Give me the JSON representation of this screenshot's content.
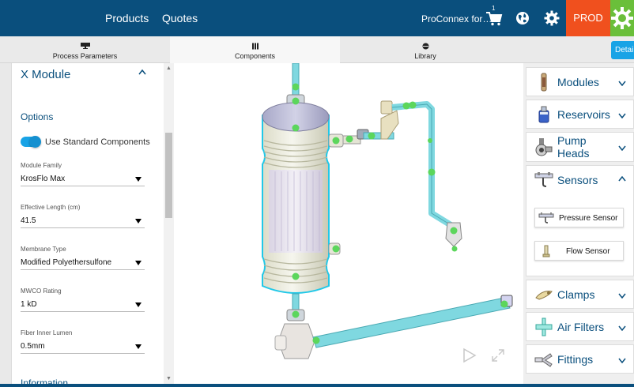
{
  "nav": {
    "products": "Products",
    "quotes": "Quotes",
    "org": "ProConnex for…",
    "cart_count": "1",
    "env": "PROD"
  },
  "tabs": [
    {
      "label": "Process Parameters",
      "icon": "monitor-icon"
    },
    {
      "label": "Components",
      "icon": "bars-icon"
    },
    {
      "label": "Library",
      "icon": "library-icon"
    }
  ],
  "detail_button": "Detai",
  "left": {
    "title": "X Module",
    "options_heading": "Options",
    "toggle_label": "Use Standard Components",
    "toggle_on": true,
    "fields": [
      {
        "label": "Module Family",
        "value": "KrosFlo Max"
      },
      {
        "label": "Effective Length (cm)",
        "value": "41.5"
      },
      {
        "label": "Membrane Type",
        "value": "Modified Polyethersulfone"
      },
      {
        "label": "MWCO Rating",
        "value": "1 kD"
      },
      {
        "label": "Fiber Inner Lumen",
        "value": "0.5mm"
      }
    ],
    "info_heading": "Information"
  },
  "right": {
    "categories": [
      {
        "label": "Modules",
        "icon": "module-icon",
        "expanded": false
      },
      {
        "label": "Reservoirs",
        "icon": "reservoir-icon",
        "expanded": false
      },
      {
        "label": "Pump Heads",
        "label_line1": "Pump",
        "label_line2": "Heads",
        "icon": "pump-head-icon",
        "expanded": false
      },
      {
        "label": "Sensors",
        "icon": "sensor-icon",
        "expanded": true
      },
      {
        "label": "Clamps",
        "icon": "clamp-icon",
        "expanded": false
      },
      {
        "label": "Air Filters",
        "icon": "air-filter-icon",
        "expanded": false
      },
      {
        "label": "Fittings",
        "icon": "fitting-icon",
        "expanded": false
      }
    ],
    "sensor_items": [
      {
        "label": "Pressure Sensor",
        "icon": "pressure-sensor-icon"
      },
      {
        "label": "Flow Sensor",
        "icon": "flow-sensor-icon"
      }
    ]
  },
  "colors": {
    "header": "#0a4f7d",
    "prod": "#f0501e",
    "accent": "#18a3e6",
    "connection_point": "#5cd65c",
    "tubing": "#7fd8e0",
    "logo": "#6abf3a"
  }
}
